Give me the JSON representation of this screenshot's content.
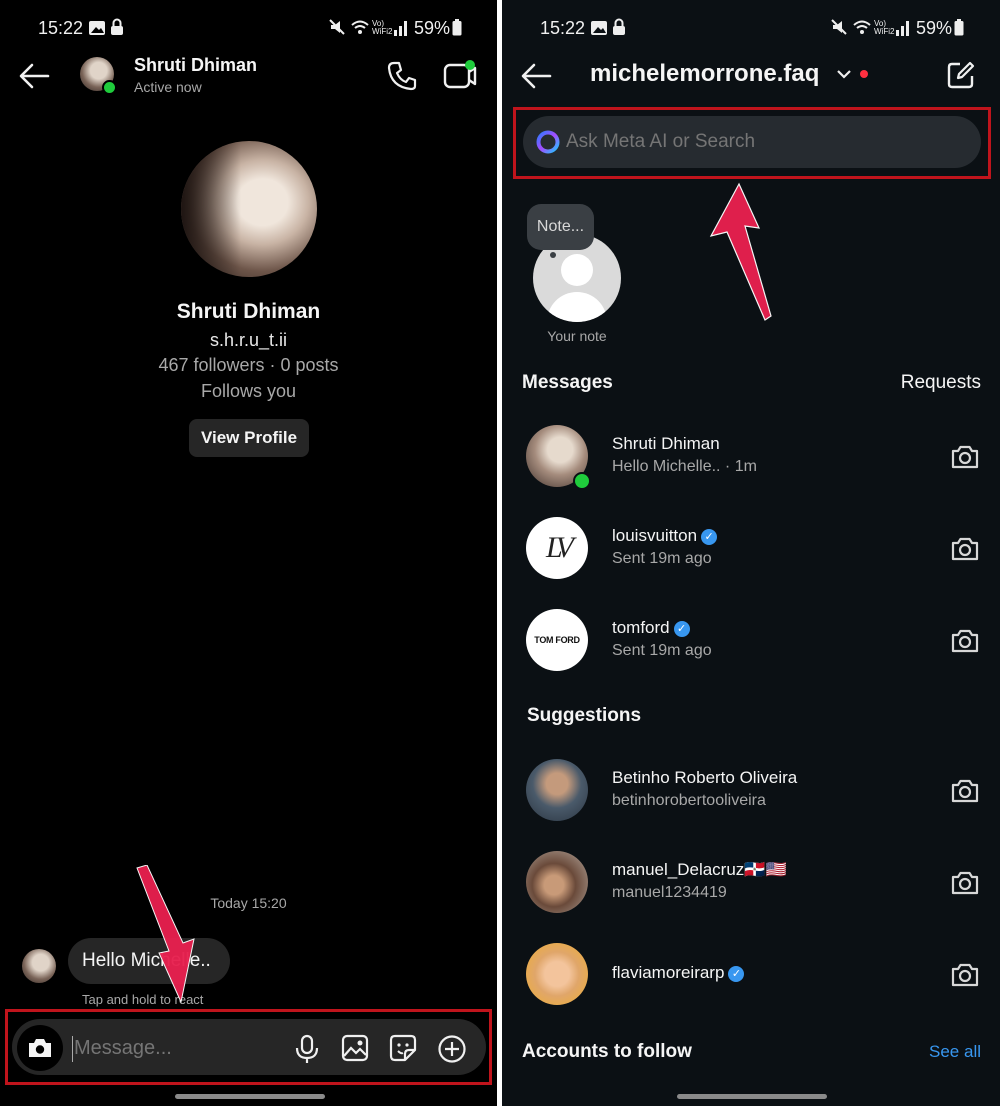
{
  "status_bar": {
    "time": "15:22",
    "battery": "59%",
    "network_label": "Vo) WiFi2"
  },
  "chat": {
    "contact_name": "Shruti Dhiman",
    "contact_status": "Active now",
    "profile_name": "Shruti Dhiman",
    "profile_handle": "s.h.r.u_t.ii",
    "profile_stats": "467 followers · 0 posts",
    "profile_follows": "Follows you",
    "view_profile_label": "View Profile",
    "timestamp": "Today 15:20",
    "bubble_text": "Hello Michelle..",
    "react_hint": "Tap and hold to react",
    "message_placeholder": "Message..."
  },
  "inbox": {
    "account_name": "michelemorrone.faq",
    "search_placeholder": "Ask Meta AI or Search",
    "note_bubble": "Note...",
    "your_note_label": "Your note",
    "messages_header": "Messages",
    "requests_label": "Requests",
    "messages": [
      {
        "name": "Shruti Dhiman",
        "sub": "Hello Michelle.. · 1m",
        "verified": false
      },
      {
        "name": "louisvuitton",
        "sub": "Sent 19m ago",
        "verified": true
      },
      {
        "name": "tomford",
        "sub": "Sent 19m ago",
        "verified": true
      }
    ],
    "suggestions_header": "Suggestions",
    "suggestions": [
      {
        "name": "Betinho Roberto Oliveira",
        "sub": "betinhorobertooliveira",
        "verified": false
      },
      {
        "name": "manuel_Delacruz🇩🇴🇺🇸",
        "sub": "manuel1234419",
        "verified": false
      },
      {
        "name": "flaviamoreirarp",
        "sub": "",
        "verified": true
      }
    ],
    "accounts_header": "Accounts to follow",
    "see_all_label": "See all",
    "logos": {
      "lv": "LV",
      "tomford": "TOM FORD"
    }
  },
  "colors": {
    "accent_blue": "#3897f0",
    "highlight_red": "#c0141c",
    "arrow_pink": "#e8204f",
    "online_green": "#1fcc3c"
  }
}
